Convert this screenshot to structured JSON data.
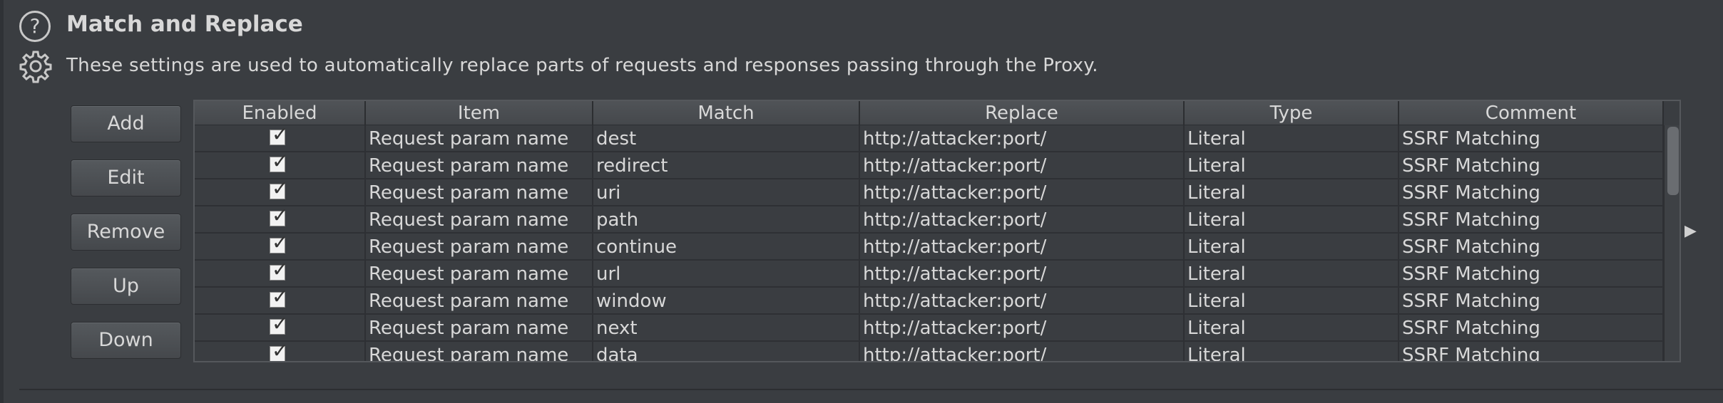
{
  "section": {
    "title": "Match and Replace",
    "description": "These settings are used to automatically replace parts of requests and responses passing through the Proxy."
  },
  "buttons": {
    "add": "Add",
    "edit": "Edit",
    "remove": "Remove",
    "up": "Up",
    "down": "Down"
  },
  "table": {
    "headers": [
      "Enabled",
      "Item",
      "Match",
      "Replace",
      "Type",
      "Comment"
    ],
    "rows": [
      {
        "enabled": true,
        "item": "Request param name",
        "match": "dest",
        "replace": "http://attacker:port/",
        "type": "Literal",
        "comment": "SSRF Matching"
      },
      {
        "enabled": true,
        "item": "Request param name",
        "match": "redirect",
        "replace": "http://attacker:port/",
        "type": "Literal",
        "comment": "SSRF Matching"
      },
      {
        "enabled": true,
        "item": "Request param name",
        "match": "uri",
        "replace": "http://attacker:port/",
        "type": "Literal",
        "comment": "SSRF Matching"
      },
      {
        "enabled": true,
        "item": "Request param name",
        "match": "path",
        "replace": "http://attacker:port/",
        "type": "Literal",
        "comment": "SSRF Matching"
      },
      {
        "enabled": true,
        "item": "Request param name",
        "match": "continue",
        "replace": "http://attacker:port/",
        "type": "Literal",
        "comment": "SSRF Matching"
      },
      {
        "enabled": true,
        "item": "Request param name",
        "match": "url",
        "replace": "http://attacker:port/",
        "type": "Literal",
        "comment": "SSRF Matching"
      },
      {
        "enabled": true,
        "item": "Request param name",
        "match": "window",
        "replace": "http://attacker:port/",
        "type": "Literal",
        "comment": "SSRF Matching"
      },
      {
        "enabled": true,
        "item": "Request param name",
        "match": "next",
        "replace": "http://attacker:port/",
        "type": "Literal",
        "comment": "SSRF Matching"
      },
      {
        "enabled": true,
        "item": "Request param name",
        "match": "data",
        "replace": "http://attacker:port/",
        "type": "Literal",
        "comment": "SSRF Matching"
      }
    ]
  },
  "icons": {
    "help": "help-icon",
    "settings": "gear-icon",
    "expand": "expand-arrow-icon"
  },
  "colors": {
    "background": "#3a3d41",
    "text": "#d8d8d8"
  }
}
